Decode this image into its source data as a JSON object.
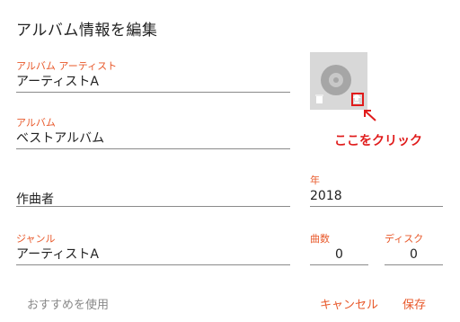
{
  "dialog": {
    "title": "アルバム情報を編集",
    "album_artist": {
      "label": "アルバム アーティスト",
      "value": "アーティストA"
    },
    "album": {
      "label": "アルバム",
      "value": "ベストアルバム"
    },
    "composer": {
      "placeholder": "作曲者"
    },
    "year": {
      "label": "年",
      "value": "2018"
    },
    "genre": {
      "label": "ジャンル",
      "value": "アーティストA"
    },
    "track_count": {
      "label": "曲数",
      "value": "0"
    },
    "disc": {
      "label": "ディスク",
      "value": "0"
    },
    "cover": {
      "icons": [
        "disc-icon",
        "trash-icon",
        "upload-icon"
      ]
    },
    "annotation": {
      "text": "ここをクリック",
      "color": "#e01b1b"
    },
    "buttons": {
      "use_suggestions": "おすすめを使用",
      "cancel": "キャンセル",
      "save": "保存"
    },
    "accent_color": "#e8582a"
  }
}
